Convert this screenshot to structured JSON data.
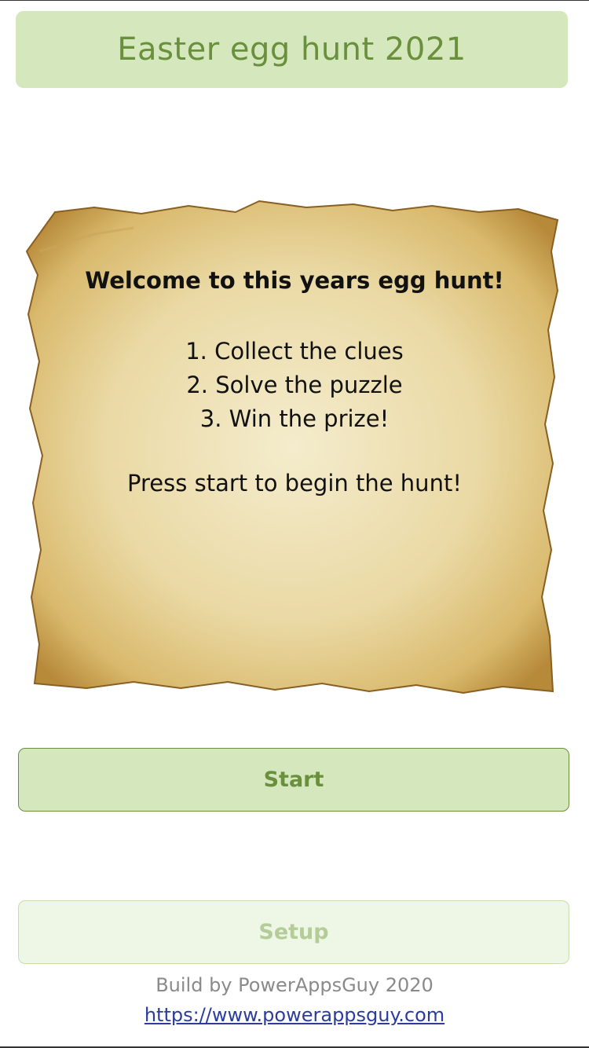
{
  "header": {
    "title": "Easter egg hunt 2021"
  },
  "parchment": {
    "welcome": "Welcome to this years egg hunt!",
    "steps": [
      "1. Collect the clues",
      "2. Solve the puzzle",
      "3. Win the prize!"
    ],
    "press_start": "Press start to begin the hunt!"
  },
  "buttons": {
    "start_label": "Start",
    "setup_label": "Setup"
  },
  "footer": {
    "build_text": "Build by PowerAppsGuy 2020",
    "link_text": "https://www.powerappsguy.com"
  },
  "colors": {
    "accent_green": "#6a8f3d",
    "button_bg": "#d5e8bd",
    "disabled_bg": "#eef6e6",
    "link_blue": "#2b3d9c"
  }
}
